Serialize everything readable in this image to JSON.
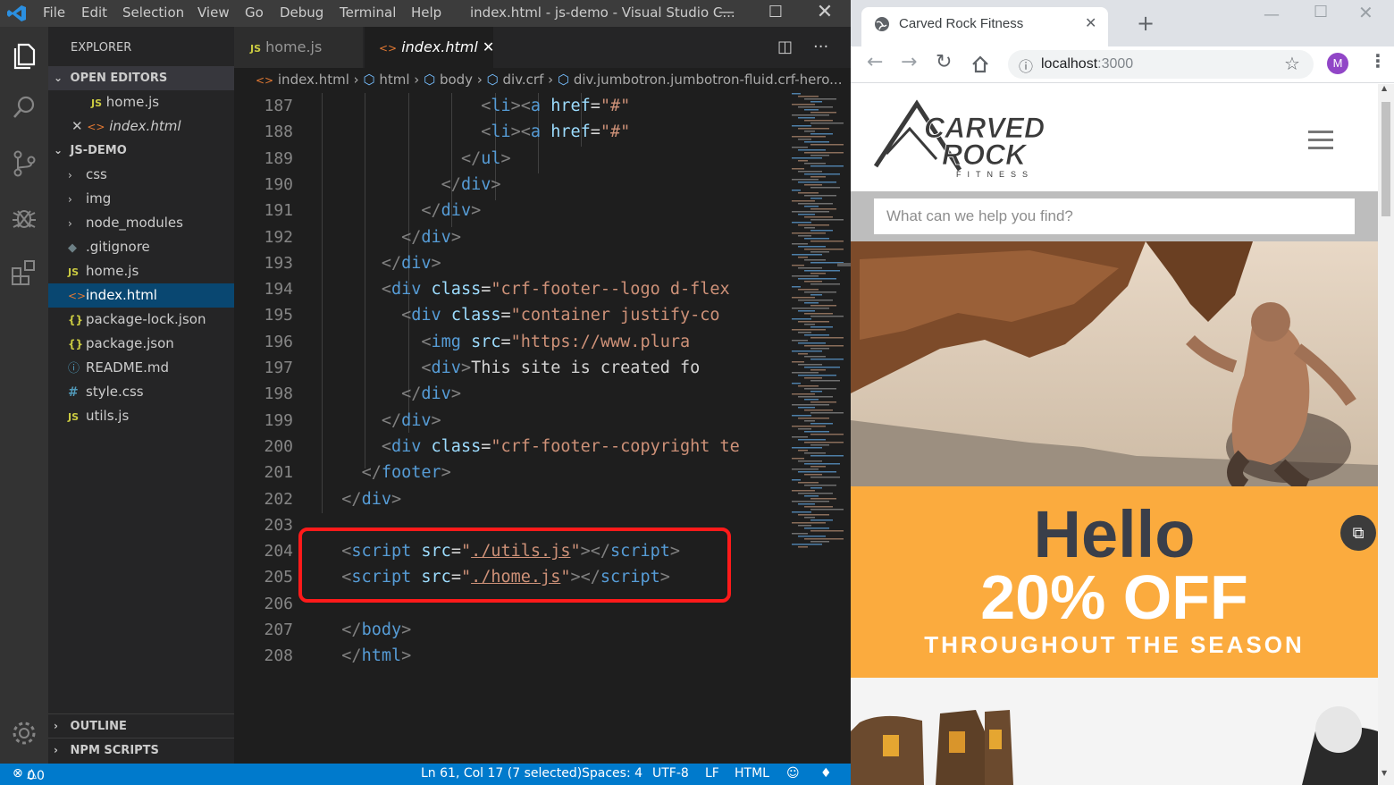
{
  "vscode": {
    "menu": [
      "File",
      "Edit",
      "Selection",
      "View",
      "Go",
      "Debug",
      "Terminal",
      "Help"
    ],
    "window_title": "index.html - js-demo - Visual Studio C...",
    "explorer_title": "EXPLORER",
    "open_editors": {
      "header": "OPEN EDITORS",
      "items": [
        {
          "name": "home.js",
          "icon": "js"
        },
        {
          "name": "index.html",
          "icon": "html"
        }
      ]
    },
    "project": {
      "header": "JS-DEMO",
      "items": [
        {
          "name": "css",
          "icon": "folder"
        },
        {
          "name": "img",
          "icon": "folder"
        },
        {
          "name": "node_modules",
          "icon": "folder"
        },
        {
          "name": ".gitignore",
          "icon": "git"
        },
        {
          "name": "home.js",
          "icon": "js"
        },
        {
          "name": "index.html",
          "icon": "html"
        },
        {
          "name": "package-lock.json",
          "icon": "json"
        },
        {
          "name": "package.json",
          "icon": "json"
        },
        {
          "name": "README.md",
          "icon": "info"
        },
        {
          "name": "style.css",
          "icon": "css"
        },
        {
          "name": "utils.js",
          "icon": "js"
        }
      ],
      "selected": "index.html"
    },
    "outline_header": "OUTLINE",
    "npm_scripts_header": "NPM SCRIPTS",
    "tabs": [
      {
        "label": "home.js",
        "active": false
      },
      {
        "label": "index.html",
        "active": true
      }
    ],
    "breadcrumb": [
      "index.html",
      "html",
      "body",
      "div.crf",
      "div.jumbotron.jumbotron-fluid.crf-hero..."
    ],
    "lines": [
      {
        "n": "187",
        "indent": "                ",
        "parts": [
          [
            "p",
            "<"
          ],
          [
            "t",
            "li"
          ],
          [
            "p",
            "><"
          ],
          [
            "t",
            "a"
          ],
          [
            "tx",
            " "
          ],
          [
            "a",
            "href"
          ],
          [
            "tx",
            "="
          ],
          [
            "s",
            "\"#\""
          ]
        ]
      },
      {
        "n": "188",
        "indent": "                ",
        "parts": [
          [
            "p",
            "<"
          ],
          [
            "t",
            "li"
          ],
          [
            "p",
            "><"
          ],
          [
            "t",
            "a"
          ],
          [
            "tx",
            " "
          ],
          [
            "a",
            "href"
          ],
          [
            "tx",
            "="
          ],
          [
            "s",
            "\"#\""
          ]
        ]
      },
      {
        "n": "189",
        "indent": "              ",
        "parts": [
          [
            "p",
            "</"
          ],
          [
            "t",
            "ul"
          ],
          [
            "p",
            ">"
          ]
        ]
      },
      {
        "n": "190",
        "indent": "            ",
        "parts": [
          [
            "p",
            "</"
          ],
          [
            "t",
            "div"
          ],
          [
            "p",
            ">"
          ]
        ]
      },
      {
        "n": "191",
        "indent": "          ",
        "parts": [
          [
            "p",
            "</"
          ],
          [
            "t",
            "div"
          ],
          [
            "p",
            ">"
          ]
        ]
      },
      {
        "n": "192",
        "indent": "        ",
        "parts": [
          [
            "p",
            "</"
          ],
          [
            "t",
            "div"
          ],
          [
            "p",
            ">"
          ]
        ]
      },
      {
        "n": "193",
        "indent": "      ",
        "parts": [
          [
            "p",
            "</"
          ],
          [
            "t",
            "div"
          ],
          [
            "p",
            ">"
          ]
        ]
      },
      {
        "n": "194",
        "indent": "      ",
        "parts": [
          [
            "p",
            "<"
          ],
          [
            "t",
            "div"
          ],
          [
            "tx",
            " "
          ],
          [
            "a",
            "class"
          ],
          [
            "tx",
            "="
          ],
          [
            "s",
            "\"crf-footer--logo d-flex"
          ]
        ]
      },
      {
        "n": "195",
        "indent": "        ",
        "parts": [
          [
            "p",
            "<"
          ],
          [
            "t",
            "div"
          ],
          [
            "tx",
            " "
          ],
          [
            "a",
            "class"
          ],
          [
            "tx",
            "="
          ],
          [
            "s",
            "\"container justify-co"
          ]
        ]
      },
      {
        "n": "196",
        "indent": "          ",
        "parts": [
          [
            "p",
            "<"
          ],
          [
            "t",
            "img"
          ],
          [
            "tx",
            " "
          ],
          [
            "a",
            "src"
          ],
          [
            "tx",
            "="
          ],
          [
            "s",
            "\"https://www.plura"
          ]
        ]
      },
      {
        "n": "197",
        "indent": "          ",
        "parts": [
          [
            "p",
            "<"
          ],
          [
            "t",
            "div"
          ],
          [
            "p",
            ">"
          ],
          [
            "tx",
            "This site is created fo"
          ]
        ]
      },
      {
        "n": "198",
        "indent": "        ",
        "parts": [
          [
            "p",
            "</"
          ],
          [
            "t",
            "div"
          ],
          [
            "p",
            ">"
          ]
        ]
      },
      {
        "n": "199",
        "indent": "      ",
        "parts": [
          [
            "p",
            "</"
          ],
          [
            "t",
            "div"
          ],
          [
            "p",
            ">"
          ]
        ]
      },
      {
        "n": "200",
        "indent": "      ",
        "parts": [
          [
            "p",
            "<"
          ],
          [
            "t",
            "div"
          ],
          [
            "tx",
            " "
          ],
          [
            "a",
            "class"
          ],
          [
            "tx",
            "="
          ],
          [
            "s",
            "\"crf-footer--copyright te"
          ]
        ]
      },
      {
        "n": "201",
        "indent": "    ",
        "parts": [
          [
            "p",
            "</"
          ],
          [
            "t",
            "footer"
          ],
          [
            "p",
            ">"
          ]
        ]
      },
      {
        "n": "202",
        "indent": "  ",
        "parts": [
          [
            "p",
            "</"
          ],
          [
            "t",
            "div"
          ],
          [
            "p",
            ">"
          ]
        ]
      },
      {
        "n": "203",
        "indent": "",
        "parts": []
      },
      {
        "n": "204",
        "indent": "  ",
        "parts": [
          [
            "p",
            "<"
          ],
          [
            "t",
            "script"
          ],
          [
            "tx",
            " "
          ],
          [
            "a",
            "src"
          ],
          [
            "tx",
            "="
          ],
          [
            "s",
            "\""
          ],
          [
            "su",
            "./utils.js"
          ],
          [
            "s",
            "\""
          ],
          [
            "p",
            "></"
          ],
          [
            "t",
            "script"
          ],
          [
            "p",
            ">"
          ]
        ]
      },
      {
        "n": "205",
        "indent": "  ",
        "parts": [
          [
            "p",
            "<"
          ],
          [
            "t",
            "script"
          ],
          [
            "tx",
            " "
          ],
          [
            "a",
            "src"
          ],
          [
            "tx",
            "="
          ],
          [
            "s",
            "\""
          ],
          [
            "su",
            "./home.js"
          ],
          [
            "s",
            "\""
          ],
          [
            "p",
            "></"
          ],
          [
            "t",
            "script"
          ],
          [
            "p",
            ">"
          ]
        ]
      },
      {
        "n": "206",
        "indent": "",
        "parts": []
      },
      {
        "n": "207",
        "indent": "  ",
        "parts": [
          [
            "p",
            "</"
          ],
          [
            "t",
            "body"
          ],
          [
            "p",
            ">"
          ]
        ]
      },
      {
        "n": "208",
        "indent": "  ",
        "parts": [
          [
            "p",
            "</"
          ],
          [
            "t",
            "html"
          ],
          [
            "p",
            ">"
          ]
        ]
      }
    ],
    "status": {
      "errors": "0",
      "warnings": "0",
      "position": "Ln 61, Col 17 (7 selected)",
      "spaces": "Spaces: 4",
      "encoding": "UTF-8",
      "eol": "LF",
      "language": "HTML"
    }
  },
  "browser": {
    "tab_title": "Carved Rock Fitness",
    "url_host": "localhost",
    "url_port": ":3000",
    "profile_initial": "M",
    "logo_text": {
      "line1": "CARVED",
      "line2": "ROCK",
      "line3": "FITNESS"
    },
    "search_placeholder": "What can we help you find?",
    "promo": {
      "hello": "Hello",
      "discount": "20% OFF",
      "subtitle": "THROUGHOUT THE SEASON"
    }
  }
}
